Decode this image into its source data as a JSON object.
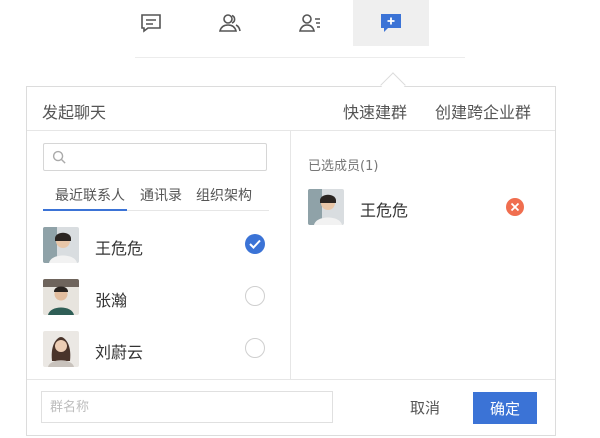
{
  "top_tabs": [
    {
      "icon": "chat-icon"
    },
    {
      "icon": "contacts-icon"
    },
    {
      "icon": "org-list-icon"
    },
    {
      "icon": "add-chat-icon",
      "active": true
    }
  ],
  "modal": {
    "title": "发起聊天",
    "links": [
      "快速建群",
      "创建跨企业群"
    ]
  },
  "search": {
    "placeholder": ""
  },
  "subtabs": [
    "最近联系人",
    "通讯录",
    "组织架构"
  ],
  "contacts": [
    {
      "name": "王危危",
      "checked": true
    },
    {
      "name": "张瀚",
      "checked": false
    },
    {
      "name": "刘蔚云",
      "checked": false
    }
  ],
  "selected": {
    "label": "已选成员(1)",
    "items": [
      {
        "name": "王危危"
      }
    ]
  },
  "footer": {
    "group_name_placeholder": "群名称",
    "cancel_label": "取消",
    "ok_label": "确定"
  },
  "colors": {
    "accent": "#3b73d6",
    "remove": "#f06e4f"
  }
}
